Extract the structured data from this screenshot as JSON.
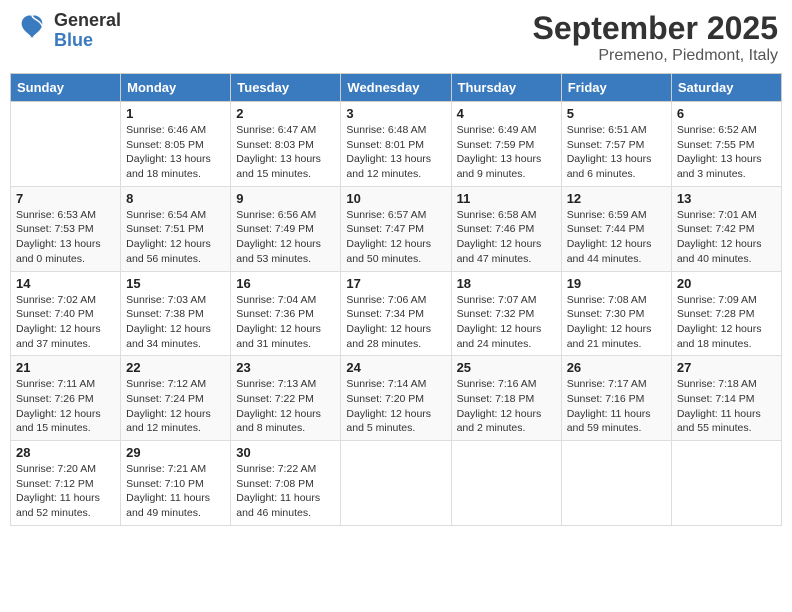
{
  "logo": {
    "general": "General",
    "blue": "Blue"
  },
  "header": {
    "month": "September 2025",
    "location": "Premeno, Piedmont, Italy"
  },
  "weekdays": [
    "Sunday",
    "Monday",
    "Tuesday",
    "Wednesday",
    "Thursday",
    "Friday",
    "Saturday"
  ],
  "weeks": [
    [
      {
        "day": "",
        "info": ""
      },
      {
        "day": "1",
        "info": "Sunrise: 6:46 AM\nSunset: 8:05 PM\nDaylight: 13 hours\nand 18 minutes."
      },
      {
        "day": "2",
        "info": "Sunrise: 6:47 AM\nSunset: 8:03 PM\nDaylight: 13 hours\nand 15 minutes."
      },
      {
        "day": "3",
        "info": "Sunrise: 6:48 AM\nSunset: 8:01 PM\nDaylight: 13 hours\nand 12 minutes."
      },
      {
        "day": "4",
        "info": "Sunrise: 6:49 AM\nSunset: 7:59 PM\nDaylight: 13 hours\nand 9 minutes."
      },
      {
        "day": "5",
        "info": "Sunrise: 6:51 AM\nSunset: 7:57 PM\nDaylight: 13 hours\nand 6 minutes."
      },
      {
        "day": "6",
        "info": "Sunrise: 6:52 AM\nSunset: 7:55 PM\nDaylight: 13 hours\nand 3 minutes."
      }
    ],
    [
      {
        "day": "7",
        "info": "Sunrise: 6:53 AM\nSunset: 7:53 PM\nDaylight: 13 hours\nand 0 minutes."
      },
      {
        "day": "8",
        "info": "Sunrise: 6:54 AM\nSunset: 7:51 PM\nDaylight: 12 hours\nand 56 minutes."
      },
      {
        "day": "9",
        "info": "Sunrise: 6:56 AM\nSunset: 7:49 PM\nDaylight: 12 hours\nand 53 minutes."
      },
      {
        "day": "10",
        "info": "Sunrise: 6:57 AM\nSunset: 7:47 PM\nDaylight: 12 hours\nand 50 minutes."
      },
      {
        "day": "11",
        "info": "Sunrise: 6:58 AM\nSunset: 7:46 PM\nDaylight: 12 hours\nand 47 minutes."
      },
      {
        "day": "12",
        "info": "Sunrise: 6:59 AM\nSunset: 7:44 PM\nDaylight: 12 hours\nand 44 minutes."
      },
      {
        "day": "13",
        "info": "Sunrise: 7:01 AM\nSunset: 7:42 PM\nDaylight: 12 hours\nand 40 minutes."
      }
    ],
    [
      {
        "day": "14",
        "info": "Sunrise: 7:02 AM\nSunset: 7:40 PM\nDaylight: 12 hours\nand 37 minutes."
      },
      {
        "day": "15",
        "info": "Sunrise: 7:03 AM\nSunset: 7:38 PM\nDaylight: 12 hours\nand 34 minutes."
      },
      {
        "day": "16",
        "info": "Sunrise: 7:04 AM\nSunset: 7:36 PM\nDaylight: 12 hours\nand 31 minutes."
      },
      {
        "day": "17",
        "info": "Sunrise: 7:06 AM\nSunset: 7:34 PM\nDaylight: 12 hours\nand 28 minutes."
      },
      {
        "day": "18",
        "info": "Sunrise: 7:07 AM\nSunset: 7:32 PM\nDaylight: 12 hours\nand 24 minutes."
      },
      {
        "day": "19",
        "info": "Sunrise: 7:08 AM\nSunset: 7:30 PM\nDaylight: 12 hours\nand 21 minutes."
      },
      {
        "day": "20",
        "info": "Sunrise: 7:09 AM\nSunset: 7:28 PM\nDaylight: 12 hours\nand 18 minutes."
      }
    ],
    [
      {
        "day": "21",
        "info": "Sunrise: 7:11 AM\nSunset: 7:26 PM\nDaylight: 12 hours\nand 15 minutes."
      },
      {
        "day": "22",
        "info": "Sunrise: 7:12 AM\nSunset: 7:24 PM\nDaylight: 12 hours\nand 12 minutes."
      },
      {
        "day": "23",
        "info": "Sunrise: 7:13 AM\nSunset: 7:22 PM\nDaylight: 12 hours\nand 8 minutes."
      },
      {
        "day": "24",
        "info": "Sunrise: 7:14 AM\nSunset: 7:20 PM\nDaylight: 12 hours\nand 5 minutes."
      },
      {
        "day": "25",
        "info": "Sunrise: 7:16 AM\nSunset: 7:18 PM\nDaylight: 12 hours\nand 2 minutes."
      },
      {
        "day": "26",
        "info": "Sunrise: 7:17 AM\nSunset: 7:16 PM\nDaylight: 11 hours\nand 59 minutes."
      },
      {
        "day": "27",
        "info": "Sunrise: 7:18 AM\nSunset: 7:14 PM\nDaylight: 11 hours\nand 55 minutes."
      }
    ],
    [
      {
        "day": "28",
        "info": "Sunrise: 7:20 AM\nSunset: 7:12 PM\nDaylight: 11 hours\nand 52 minutes."
      },
      {
        "day": "29",
        "info": "Sunrise: 7:21 AM\nSunset: 7:10 PM\nDaylight: 11 hours\nand 49 minutes."
      },
      {
        "day": "30",
        "info": "Sunrise: 7:22 AM\nSunset: 7:08 PM\nDaylight: 11 hours\nand 46 minutes."
      },
      {
        "day": "",
        "info": ""
      },
      {
        "day": "",
        "info": ""
      },
      {
        "day": "",
        "info": ""
      },
      {
        "day": "",
        "info": ""
      }
    ]
  ]
}
